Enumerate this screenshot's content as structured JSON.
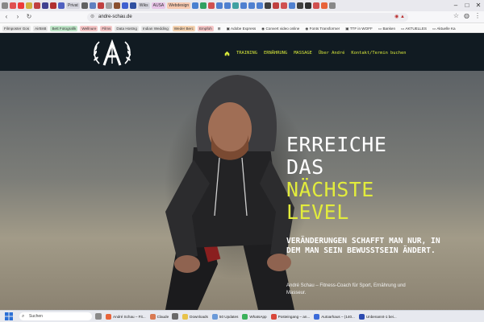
{
  "browser": {
    "tabs": [
      {
        "label": "Privat",
        "color": "#7aa8e0"
      },
      {
        "label": "Wiks",
        "color": "#bfbfc8"
      },
      {
        "label": "AUSA",
        "color": "#d88fd8"
      },
      {
        "label": "Webdesign",
        "color": "#f3a37a"
      }
    ],
    "url": "andre-schau.de",
    "bookmarks": [
      {
        "label": "Filmposter Gos",
        "bg": "#e6e6e6"
      },
      {
        "label": "AirBnB",
        "bg": "#e6e6e6"
      },
      {
        "label": "Bett Fotografik",
        "bg": "#bfe6c8"
      },
      {
        "label": "Wellnure",
        "bg": "#f6c7c7"
      },
      {
        "label": "Films",
        "bg": "#f6c7c7"
      },
      {
        "label": "Data Hostng",
        "bg": "#e6e6e6"
      },
      {
        "label": "Indian Wedding",
        "bg": "#e6e6e6"
      },
      {
        "label": "Weder Berc",
        "bg": "#f6d3b0"
      },
      {
        "label": "Empfoh",
        "bg": "#f6c7c7"
      },
      {
        "label": "Adobe Express",
        "bg": "transparent"
      },
      {
        "label": "Convert video online",
        "bg": "transparent"
      },
      {
        "label": "Fonts Transformer",
        "bg": "transparent"
      },
      {
        "label": "TTF in WOFF",
        "bg": "transparent"
      },
      {
        "label": "Banken",
        "bg": "transparent"
      },
      {
        "label": "AKTUELLES",
        "bg": "transparent"
      },
      {
        "label": "Aktuelle Ka",
        "bg": "transparent"
      }
    ]
  },
  "site": {
    "nav": [
      "TRAINING",
      "ERNÄHRUNG",
      "MASSAGE",
      "Über André",
      "Kontakt/Termin buchen"
    ],
    "headline": {
      "line1": "ERREICHE",
      "line2": "DAS",
      "line3": "NÄCHSTE",
      "line4": "LEVEL"
    },
    "subtitle": "VERÄNDERUNGEN SCHAFFT MAN NUR, IN DEM MAN SEIN BEWUSSTSEIN ÄNDERT.",
    "caption": "André Schau – Fitness-Coach für Sport, Ernährung und Masseur.",
    "accent": "#e2ec3c",
    "nav_bg": "#111b22"
  },
  "taskbar": {
    "search": "Suchen",
    "items": [
      {
        "label": "André Schau – Fit...",
        "color": "#e8643a"
      },
      {
        "label": "Claude",
        "color": "#d97a52"
      },
      {
        "label": "Downloads",
        "color": "#e8c34a"
      },
      {
        "label": "50 Updates",
        "color": "#6a9ad9"
      },
      {
        "label": "WhatsApp",
        "color": "#3bb15b"
      },
      {
        "label": "Posteingang – an...",
        "color": "#d9483b"
      },
      {
        "label": "Autoarhaus – (140...",
        "color": "#3b6ad9"
      },
      {
        "label": "Unbenannt-1 bei...",
        "color": "#2b4ab0"
      }
    ]
  }
}
